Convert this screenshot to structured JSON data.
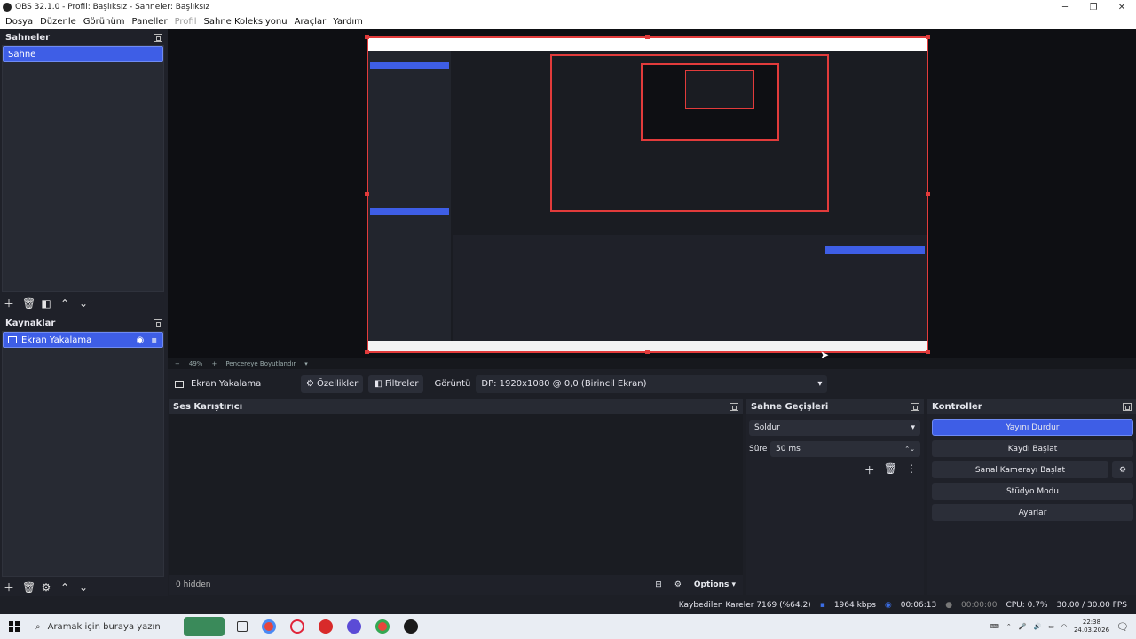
{
  "window": {
    "title": "OBS 32.1.0 - Profil: Başlıksız - Sahneler: Başlıksız"
  },
  "menu": [
    "Dosya",
    "Düzenle",
    "Görünüm",
    "Paneller",
    "Profil",
    "Sahne Koleksiyonu",
    "Araçlar",
    "Yardım"
  ],
  "scenes": {
    "header": "Sahneler",
    "items": [
      "Sahne"
    ]
  },
  "sources": {
    "header": "Kaynaklar",
    "items": [
      "Ekran Yakalama"
    ]
  },
  "zoom": {
    "minus": "−",
    "percent": "49%",
    "plus": "+",
    "fit_label": "Pencereye Boyutlandır"
  },
  "source_bar": {
    "name": "Ekran Yakalama",
    "properties": "Özellikler",
    "filters": "Filtreler",
    "display_label": "Görüntü",
    "display_value": "DP: 1920x1080 @ 0,0 (Birincil Ekran)"
  },
  "mixer": {
    "header": "Ses Karıştırıcı",
    "hidden": "0 hidden",
    "options": "Options"
  },
  "transitions": {
    "header": "Sahne Geçişleri",
    "type": "Soldur",
    "duration_label": "Süre",
    "duration_value": "50 ms"
  },
  "controls": {
    "header": "Kontroller",
    "stop_stream": "Yayını Durdur",
    "start_record": "Kaydı Başlat",
    "start_vcam": "Sanal Kamerayı Başlat",
    "studio_mode": "Stüdyo Modu",
    "settings": "Ayarlar"
  },
  "status": {
    "dropped": "Kaybedilen Kareler 7169 (%64.2)",
    "bitrate": "1964 kbps",
    "stream_time": "00:06:13",
    "record_time": "00:00:00",
    "cpu": "CPU: 0.7%",
    "fps": "30.00 / 30.00 FPS"
  },
  "taskbar": {
    "search_placeholder": "Aramak için buraya yazın",
    "time": "22:38",
    "date": "24.03.2026"
  },
  "colors": {
    "accent": "#3e5ee6",
    "selection_border": "#e23b3b",
    "live": "#3b6ee6"
  }
}
